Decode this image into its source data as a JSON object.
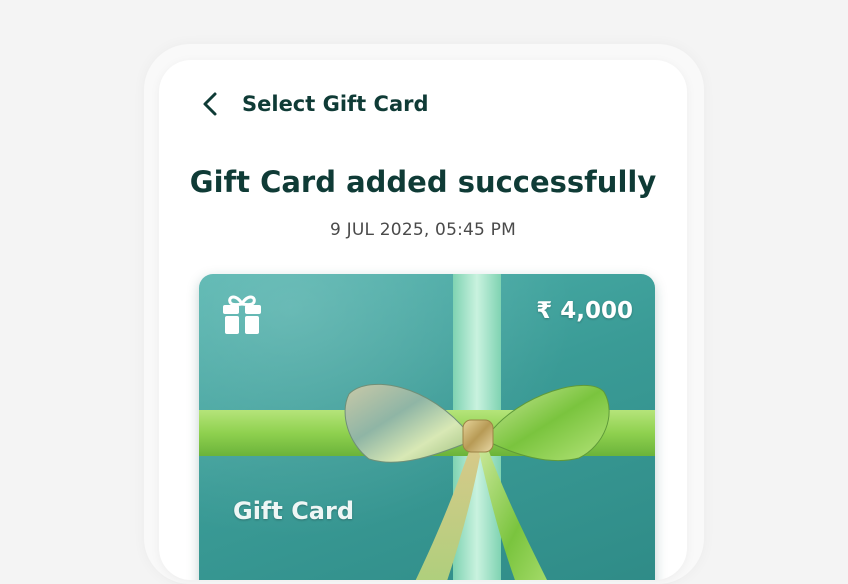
{
  "header": {
    "title": "Select Gift Card",
    "back_icon": "chevron-left-icon"
  },
  "main": {
    "headline": "Gift Card added successfully",
    "timestamp": "9 JUL 2025, 05:45 PM"
  },
  "card": {
    "amount": "₹ 4,000",
    "label": "Gift Card",
    "icon": "gift-icon",
    "colors": {
      "card": "#3a9b96",
      "ribbon_vertical": "#a8e6cf",
      "ribbon_horizontal": "#8fd14f"
    }
  },
  "colors": {
    "text_primary": "#0f3b36",
    "text_secondary": "#4a4a4a",
    "background": "#f4f4f4"
  }
}
